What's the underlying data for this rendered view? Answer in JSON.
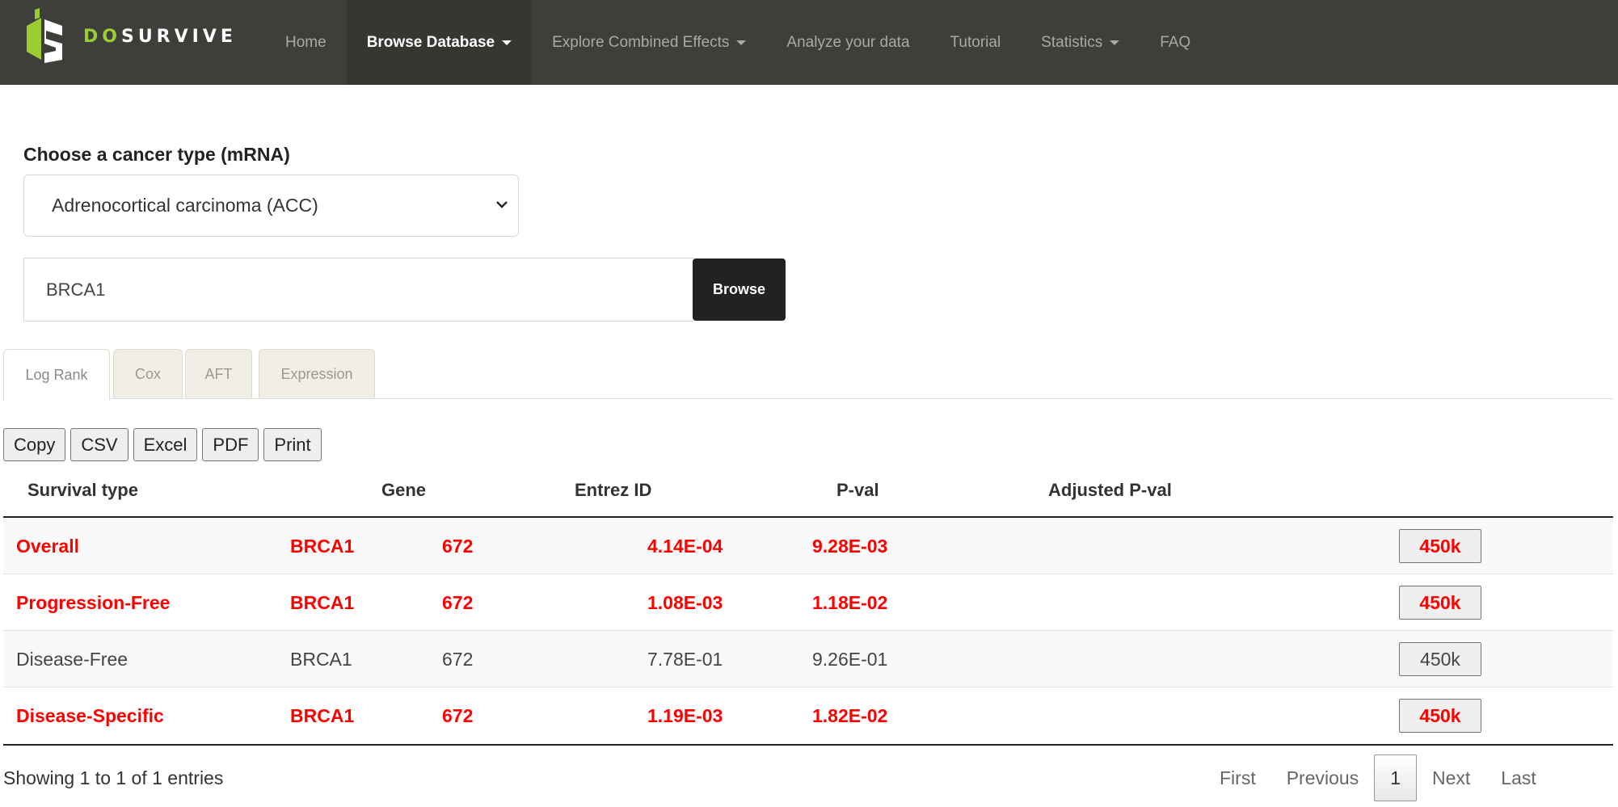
{
  "brand": {
    "prefix": "DO",
    "suffix": "SURVIVE",
    "accent": "#9acd32"
  },
  "nav": {
    "items": [
      {
        "label": "Home",
        "dropdown": false,
        "active": false
      },
      {
        "label": "Browse Database",
        "dropdown": true,
        "active": true
      },
      {
        "label": "Explore Combined Effects",
        "dropdown": true,
        "active": false
      },
      {
        "label": "Analyze your data",
        "dropdown": false,
        "active": false
      },
      {
        "label": "Tutorial",
        "dropdown": false,
        "active": false
      },
      {
        "label": "Statistics",
        "dropdown": true,
        "active": false
      },
      {
        "label": "FAQ",
        "dropdown": false,
        "active": false
      }
    ]
  },
  "form": {
    "cancer_label": "Choose a cancer type (mRNA)",
    "cancer_selected": "Adrenocortical carcinoma (ACC)",
    "gene_value": "BRCA1",
    "browse_label": "Browse"
  },
  "tabs": [
    {
      "label": "Log Rank",
      "active": true
    },
    {
      "label": "Cox",
      "active": false
    },
    {
      "label": "AFT",
      "active": false
    },
    {
      "label": "Expression",
      "active": false
    }
  ],
  "export_buttons": [
    "Copy",
    "CSV",
    "Excel",
    "PDF",
    "Print"
  ],
  "table": {
    "columns": [
      "Survival type",
      "Gene",
      "Entrez ID",
      "P-val",
      "Adjusted P-val"
    ],
    "rows": [
      {
        "survival_type": "Overall",
        "gene": "BRCA1",
        "entrez_id": "672",
        "p_val": "4.14E-04",
        "adj_p_val": "9.28E-03",
        "action": "450k",
        "significant": true
      },
      {
        "survival_type": "Progression-Free",
        "gene": "BRCA1",
        "entrez_id": "672",
        "p_val": "1.08E-03",
        "adj_p_val": "1.18E-02",
        "action": "450k",
        "significant": true
      },
      {
        "survival_type": "Disease-Free",
        "gene": "BRCA1",
        "entrez_id": "672",
        "p_val": "7.78E-01",
        "adj_p_val": "9.26E-01",
        "action": "450k",
        "significant": false
      },
      {
        "survival_type": "Disease-Specific",
        "gene": "BRCA1",
        "entrez_id": "672",
        "p_val": "1.19E-03",
        "adj_p_val": "1.82E-02",
        "action": "450k",
        "significant": true
      }
    ],
    "significant_color": "#ff0000"
  },
  "footer": {
    "info": "Showing 1 to 1 of 1 entries",
    "pager": {
      "first": "First",
      "previous": "Previous",
      "current": "1",
      "next": "Next",
      "last": "Last"
    }
  }
}
